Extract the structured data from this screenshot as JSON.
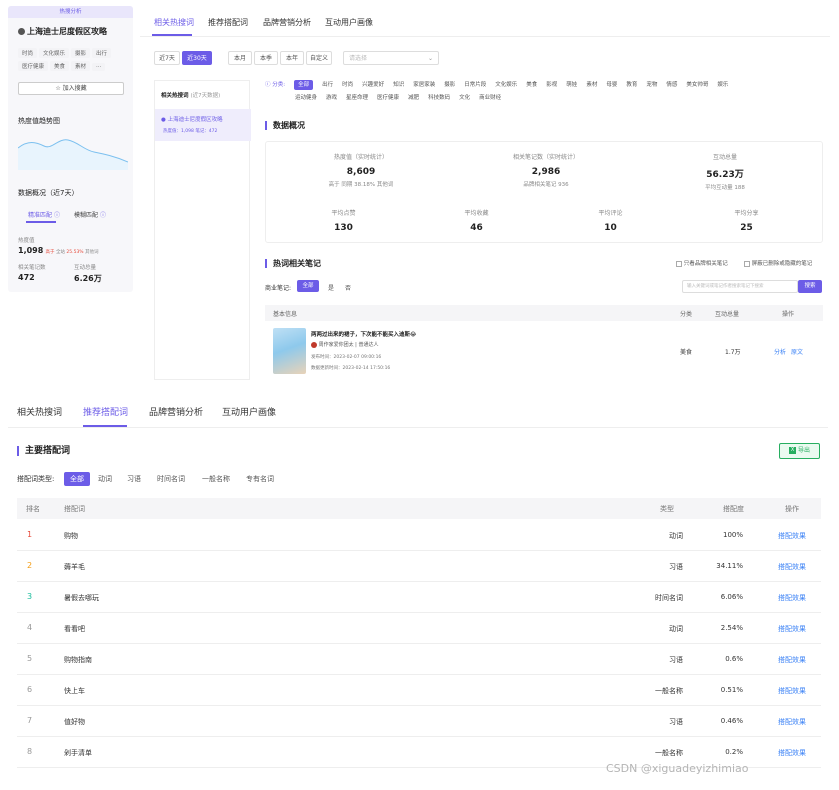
{
  "left_panel": {
    "header_tag": "热搜分析",
    "title": "上海迪士尼度假区攻略",
    "tags": [
      "时尚",
      "文化娱乐",
      "摄影",
      "出行",
      "医疗健康",
      "美食",
      "素材",
      "···"
    ],
    "add_button": "加入搜藏",
    "trend_title": "热度值趋势图",
    "overview_title": "数据概况（近7天）",
    "tabs": [
      "精准匹配",
      "模糊匹配"
    ],
    "metric1_label": "热度值",
    "metric1_value": "1,098",
    "metric1_note_prefix": "高于",
    "metric1_note_scope": "全站",
    "metric1_note_pct": "25.53%",
    "metric1_note_suffix": "其他词",
    "metric2_label": "相关笔记数",
    "metric2_value": "472",
    "metric3_label": "互动总量",
    "metric3_value": "6.26万"
  },
  "top_tabs": [
    "相关热搜词",
    "推荐搭配词",
    "品牌营销分析",
    "互动用户画像"
  ],
  "date_filters": [
    "近7天",
    "近30天"
  ],
  "period_filters": [
    "本月",
    "本季",
    "本年",
    "自定义"
  ],
  "select_placeholder": "请选择",
  "related_list": {
    "header": "相关热搜词",
    "header_note": "(近7天数据)",
    "item_title": "上海迪士尼度假区攻略",
    "item_meta": "热度值：1,098  笔记：472"
  },
  "categories_label": "分类:",
  "categories_row1": [
    "全部",
    "出行",
    "时尚",
    "兴趣爱好",
    "知识",
    "家居家装",
    "摄影",
    "日常片段",
    "文化娱乐",
    "美食",
    "影视",
    "萌娃",
    "素材",
    "母婴",
    "教育",
    "宠物",
    "情感",
    "美女帅哥",
    "娱乐"
  ],
  "categories_row2": [
    "运动健身",
    "游戏",
    "星座命理",
    "医疗健康",
    "减肥",
    "科技数码",
    "文化",
    "商业财经"
  ],
  "data_overview": {
    "title": "数据概况",
    "stats_top": [
      {
        "label": "热度值（实时统计）",
        "value": "8,609",
        "note": "高于 同期 38.18% 其他词"
      },
      {
        "label": "相关笔记数（实时统计）",
        "value": "2,986",
        "note": "品牌相关笔记 936"
      },
      {
        "label": "互动总量",
        "value": "56.23万",
        "note": "平均互动量 188"
      }
    ],
    "stats_bottom": [
      {
        "label": "平均点赞",
        "value": "130"
      },
      {
        "label": "平均收藏",
        "value": "46"
      },
      {
        "label": "平均评论",
        "value": "10"
      },
      {
        "label": "平均分享",
        "value": "25"
      }
    ]
  },
  "hot_notes": {
    "title": "热词相关笔记",
    "check1": "只看品牌相关笔记",
    "check2": "屏蔽已删除或隐藏的笔记",
    "filter_label": "商业笔记:",
    "filter_opts": [
      "全部",
      "是",
      "否"
    ],
    "search_placeholder": "输入关键词或笔记作者搜索笔记下搜索",
    "search_btn": "搜索",
    "col_info": "基本信息",
    "col_cat": "分类",
    "col_total": "互动总量",
    "col_op": "操作",
    "note_title": "两两过出来的裙子，下次能不能买入迪斯😂",
    "note_author": "周作家爱你团太  | 普通达人",
    "note_pub": "发布时间：2023-02-07 09:00:16",
    "note_update": "数据更新时间：2023-02-14 17:50:16",
    "note_cat": "美食",
    "note_total": "1.7万",
    "op_analyze": "分析",
    "op_source": "原文"
  },
  "bottom_tabs": [
    "相关热搜词",
    "推荐搭配词",
    "品牌营销分析",
    "互动用户画像"
  ],
  "main_collocations": {
    "title": "主要搭配词",
    "export_btn": "导出",
    "type_label": "搭配词类型:",
    "types": [
      "全部",
      "动词",
      "习语",
      "时间名词",
      "一般名称",
      "专有名词"
    ],
    "columns": [
      "排名",
      "搭配词",
      "类型",
      "搭配度",
      "操作"
    ],
    "rows": [
      {
        "rank": "1",
        "word": "购物",
        "type": "动词",
        "degree": "100%",
        "op": "搭配效果"
      },
      {
        "rank": "2",
        "word": "薅羊毛",
        "type": "习语",
        "degree": "34.11%",
        "op": "搭配效果"
      },
      {
        "rank": "3",
        "word": "暑假去哪玩",
        "type": "时间名词",
        "degree": "6.06%",
        "op": "搭配效果"
      },
      {
        "rank": "4",
        "word": "看看吧",
        "type": "动词",
        "degree": "2.54%",
        "op": "搭配效果"
      },
      {
        "rank": "5",
        "word": "购物指南",
        "type": "习语",
        "degree": "0.6%",
        "op": "搭配效果"
      },
      {
        "rank": "6",
        "word": "快上车",
        "type": "一般名称",
        "degree": "0.51%",
        "op": "搭配效果"
      },
      {
        "rank": "7",
        "word": "值好物",
        "type": "习语",
        "degree": "0.46%",
        "op": "搭配效果"
      },
      {
        "rank": "8",
        "word": "剁手清单",
        "type": "一般名称",
        "degree": "0.2%",
        "op": "搭配效果"
      }
    ],
    "rank_colors": [
      "#e74c3c",
      "#f39c12",
      "#1abc9c",
      "#999999",
      "#999999",
      "#999999",
      "#999999",
      "#999999"
    ]
  },
  "watermark": "CSDN @xiguadeyizhimiao",
  "colors": {
    "accent": "#6c5ce7",
    "link": "#3b82f6",
    "up": "#e74c3c"
  }
}
